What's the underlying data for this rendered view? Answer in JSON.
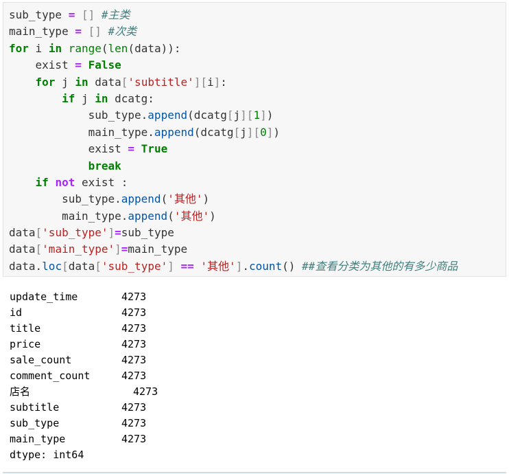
{
  "code_lines": [
    [
      [
        "var",
        "sub_type "
      ],
      [
        "op",
        "="
      ],
      [
        "var",
        " "
      ],
      [
        "br",
        "[]"
      ],
      [
        "var",
        " "
      ],
      [
        "cm",
        "#主类"
      ]
    ],
    [
      [
        "var",
        "main_type "
      ],
      [
        "op",
        "="
      ],
      [
        "var",
        " "
      ],
      [
        "br",
        "[]"
      ],
      [
        "var",
        " "
      ],
      [
        "cm",
        "#次类"
      ]
    ],
    [
      [
        "kw",
        "for"
      ],
      [
        "var",
        " i "
      ],
      [
        "kw",
        "in"
      ],
      [
        "var",
        " "
      ],
      [
        "builtin",
        "range"
      ],
      [
        "var",
        "("
      ],
      [
        "builtin",
        "len"
      ],
      [
        "var",
        "(data)):"
      ]
    ],
    [
      [
        "var",
        "    exist "
      ],
      [
        "op",
        "="
      ],
      [
        "var",
        " "
      ],
      [
        "kw",
        "False"
      ]
    ],
    [
      [
        "var",
        "    "
      ],
      [
        "kw",
        "for"
      ],
      [
        "var",
        " j "
      ],
      [
        "kw",
        "in"
      ],
      [
        "var",
        " data"
      ],
      [
        "br",
        "["
      ],
      [
        "str",
        "'subtitle'"
      ],
      [
        "br",
        "]["
      ],
      [
        "var",
        "i"
      ],
      [
        "br",
        "]"
      ],
      [
        "var",
        ":"
      ]
    ],
    [
      [
        "var",
        "        "
      ],
      [
        "kw",
        "if"
      ],
      [
        "var",
        " j "
      ],
      [
        "kw",
        "in"
      ],
      [
        "var",
        " dcatg:"
      ]
    ],
    [
      [
        "var",
        "            sub_type."
      ],
      [
        "attr",
        "append"
      ],
      [
        "var",
        "(dcatg"
      ],
      [
        "br",
        "["
      ],
      [
        "var",
        "j"
      ],
      [
        "br",
        "]["
      ],
      [
        "num",
        "1"
      ],
      [
        "br",
        "]"
      ],
      [
        "var",
        ")"
      ]
    ],
    [
      [
        "var",
        "            main_type."
      ],
      [
        "attr",
        "append"
      ],
      [
        "var",
        "(dcatg"
      ],
      [
        "br",
        "["
      ],
      [
        "var",
        "j"
      ],
      [
        "br",
        "]["
      ],
      [
        "num",
        "0"
      ],
      [
        "br",
        "]"
      ],
      [
        "var",
        ")"
      ]
    ],
    [
      [
        "var",
        "            exist "
      ],
      [
        "op",
        "="
      ],
      [
        "var",
        " "
      ],
      [
        "kw",
        "True"
      ]
    ],
    [
      [
        "var",
        "            "
      ],
      [
        "kw",
        "break"
      ]
    ],
    [
      [
        "var",
        "    "
      ],
      [
        "kw",
        "if"
      ],
      [
        "var",
        " "
      ],
      [
        "op",
        "not"
      ],
      [
        "var",
        " exist :"
      ]
    ],
    [
      [
        "var",
        "        sub_type."
      ],
      [
        "attr",
        "append"
      ],
      [
        "var",
        "("
      ],
      [
        "str",
        "'其他'"
      ],
      [
        "var",
        ")"
      ]
    ],
    [
      [
        "var",
        "        main_type."
      ],
      [
        "attr",
        "append"
      ],
      [
        "var",
        "("
      ],
      [
        "str",
        "'其他'"
      ],
      [
        "var",
        ")"
      ]
    ],
    [
      [
        "var",
        "data"
      ],
      [
        "br",
        "["
      ],
      [
        "str",
        "'sub_type'"
      ],
      [
        "br",
        "]"
      ],
      [
        "op",
        "="
      ],
      [
        "var",
        "sub_type"
      ]
    ],
    [
      [
        "var",
        "data"
      ],
      [
        "br",
        "["
      ],
      [
        "str",
        "'main_type'"
      ],
      [
        "br",
        "]"
      ],
      [
        "op",
        "="
      ],
      [
        "var",
        "main_type"
      ]
    ],
    [
      [
        "var",
        "data."
      ],
      [
        "attr",
        "loc"
      ],
      [
        "br",
        "["
      ],
      [
        "var",
        "data"
      ],
      [
        "br",
        "["
      ],
      [
        "str",
        "'sub_type'"
      ],
      [
        "br",
        "]"
      ],
      [
        "var",
        " "
      ],
      [
        "op",
        "=="
      ],
      [
        "var",
        " "
      ],
      [
        "str",
        "'其他'"
      ],
      [
        "br",
        "]"
      ],
      [
        "var",
        "."
      ],
      [
        "attr",
        "count"
      ],
      [
        "var",
        "() "
      ],
      [
        "cm",
        "##查看分类为其他的有多少商品"
      ]
    ]
  ],
  "output": {
    "rows": [
      {
        "key": "update_time",
        "value": "4273"
      },
      {
        "key": "id",
        "value": "4273"
      },
      {
        "key": "title",
        "value": "4273"
      },
      {
        "key": "price",
        "value": "4273"
      },
      {
        "key": "sale_count",
        "value": "4273"
      },
      {
        "key": "comment_count",
        "value": "4273"
      },
      {
        "key": "店名",
        "value": "4273",
        "wide": true
      },
      {
        "key": "subtitle",
        "value": "4273"
      },
      {
        "key": "sub_type",
        "value": "4273"
      },
      {
        "key": "main_type",
        "value": "4273"
      }
    ],
    "dtype_line": "dtype: int64"
  }
}
